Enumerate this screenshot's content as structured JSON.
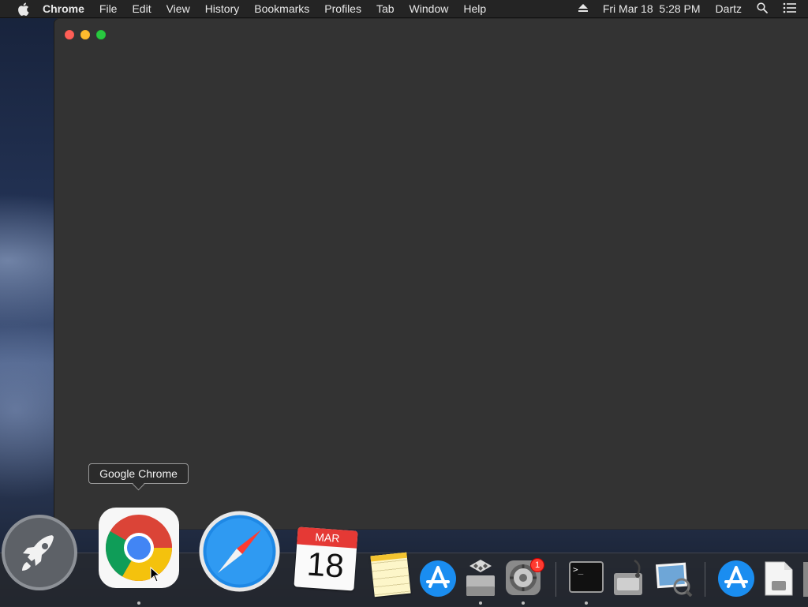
{
  "menubar": {
    "apple_icon": "apple-icon",
    "items": [
      "Chrome",
      "File",
      "Edit",
      "View",
      "History",
      "Bookmarks",
      "Profiles",
      "Tab",
      "Window",
      "Help"
    ],
    "status": {
      "eject_icon": "eject-icon",
      "datetime": "Fri Mar 18  5:28 PM",
      "user": "Dartz",
      "search_icon": "spotlight-icon",
      "notification_icon": "notification-center-icon"
    }
  },
  "window": {
    "app": "Chrome",
    "controls": [
      "close",
      "minimize",
      "zoom"
    ],
    "background": "#333333"
  },
  "tooltip": {
    "label": "Google Chrome"
  },
  "dock": {
    "items": [
      {
        "name": "Launchpad",
        "icon": "launchpad-icon",
        "running": false
      },
      {
        "name": "Google Chrome",
        "icon": "chrome-icon",
        "running": true,
        "hovered": true
      },
      {
        "name": "Safari",
        "icon": "safari-icon",
        "running": false
      },
      {
        "name": "Calendar",
        "icon": "calendar-icon",
        "running": false,
        "month": "MAR",
        "day": "18"
      },
      {
        "name": "Notes",
        "icon": "notes-icon",
        "running": false
      },
      {
        "name": "App Store",
        "icon": "app-store-icon",
        "running": false
      },
      {
        "name": "Boot Camp Assistant",
        "icon": "bootcamp-icon",
        "running": true
      },
      {
        "name": "System Preferences",
        "icon": "system-preferences-icon",
        "running": true,
        "badge": "1"
      },
      {
        "name": "Terminal",
        "icon": "terminal-icon",
        "running": true
      },
      {
        "name": "Disk Utility",
        "icon": "disk-utility-icon",
        "running": false
      },
      {
        "name": "Preview",
        "icon": "preview-icon",
        "running": false
      },
      {
        "name": "App Store",
        "icon": "app-store-icon",
        "running": false
      },
      {
        "name": "Disk Image",
        "icon": "disk-image-icon",
        "running": false
      }
    ]
  },
  "colors": {
    "menubar": "#242424",
    "window": "#333333",
    "close": "#fe5f57",
    "minimize": "#febb2e",
    "zoom": "#29c840",
    "badge": "#ff3b30"
  }
}
